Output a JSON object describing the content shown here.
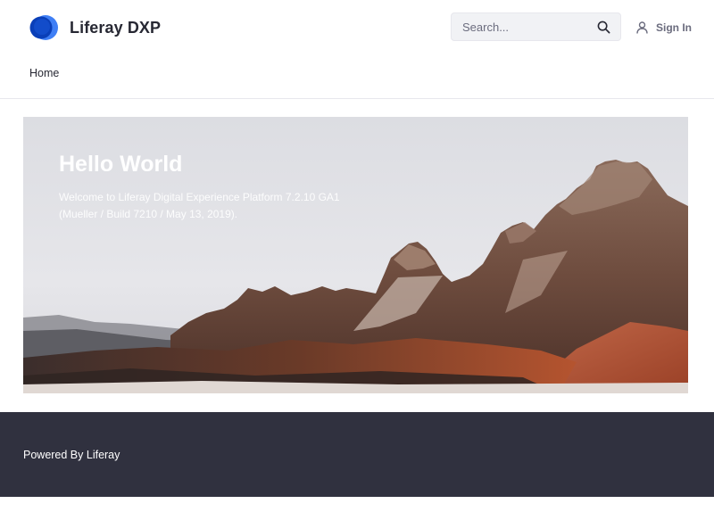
{
  "header": {
    "site_name": "Liferay DXP",
    "logo_icon": "liferay-logo-icon",
    "search": {
      "placeholder": "Search...",
      "value": "",
      "icon": "search-icon"
    },
    "sign_in": {
      "label": "Sign In",
      "icon": "user-icon"
    }
  },
  "nav": {
    "items": [
      {
        "label": "Home"
      }
    ]
  },
  "hero": {
    "title": "Hello World",
    "text": "Welcome to Liferay Digital Experience Platform 7.2.10 GA1 (Mueller / Build 7210 / May 13, 2019)."
  },
  "footer": {
    "text": "Powered By Liferay"
  },
  "colors": {
    "brand_blue": "#0b5fff",
    "footer_bg": "#30313f",
    "text_dark": "#272833",
    "text_muted": "#6b6c7e"
  }
}
